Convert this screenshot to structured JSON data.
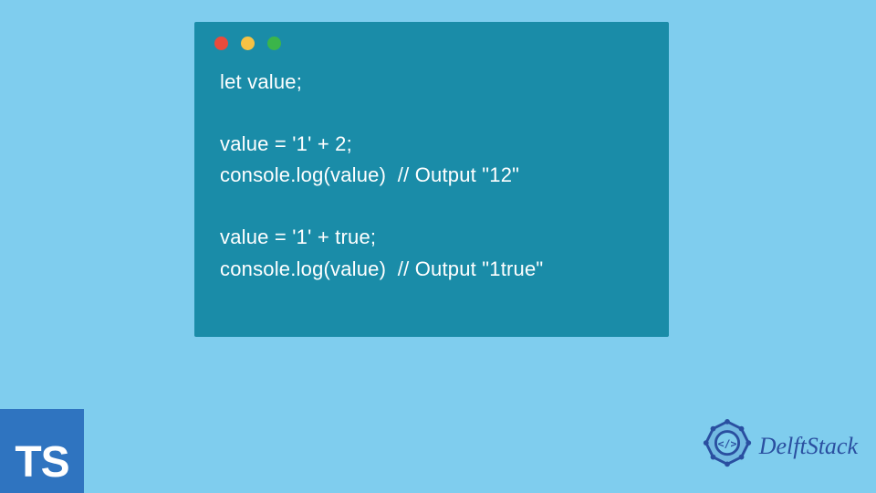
{
  "window": {
    "dots": [
      "red",
      "yellow",
      "green"
    ]
  },
  "code": {
    "lines": [
      "let value;",
      "",
      "value = '1' + 2;",
      "console.log(value)  // Output \"12\"",
      "",
      "value = '1' + true;",
      "console.log(value)  // Output \"1true\""
    ]
  },
  "ts_badge": {
    "label": "TS"
  },
  "brand": {
    "name": "DelftStack",
    "logo_alt": "delftstack-logo"
  },
  "colors": {
    "page_bg": "#7fcdee",
    "window_bg": "#1a8ca8",
    "ts_bg": "#2f74c0",
    "brand_color": "#2a4fa0"
  }
}
